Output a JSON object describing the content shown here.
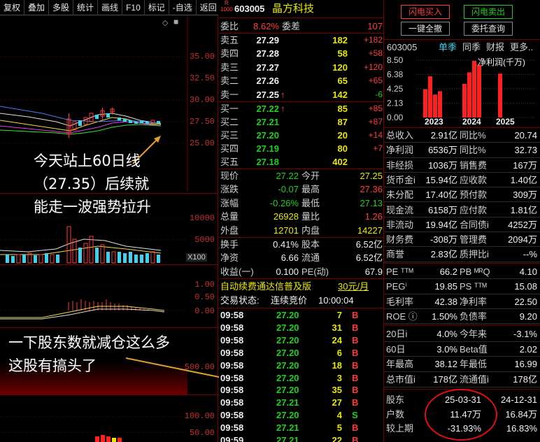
{
  "toolbar": {
    "items": [
      "复权",
      "叠加",
      "多股",
      "统计",
      "画线",
      "F10",
      "标记",
      "-自选",
      "返回"
    ]
  },
  "chart": {
    "price_ticks": [
      "35.00",
      "32.50",
      "30.00",
      "27.50",
      "25.00"
    ],
    "volume_ticks": [
      "10000",
      "5000"
    ],
    "volume_unit": "X100",
    "macd_ticks": [
      "1.00",
      "0.50",
      "0.00"
    ],
    "holder_ticks": [
      "500.00"
    ],
    "bottom_ticks": [
      "100.00",
      "50.00"
    ],
    "note1": [
      "今天站上60日线",
      "（27.35）后续就",
      "能走一波强势拉升"
    ],
    "note2": [
      "一下股东数就减仓这么多",
      "这股有搞头了"
    ]
  },
  "quote": {
    "badge_top": "R",
    "badge_bottom": "1000",
    "code": "603005",
    "name": "晶方科技",
    "wb_label": "委比",
    "wb_value": "8.62%",
    "wc_label": "委差",
    "wc_value": "107",
    "asks": [
      {
        "label": "卖五",
        "price": "27.29",
        "vol": "182",
        "chg": "+182"
      },
      {
        "label": "卖四",
        "price": "27.28",
        "vol": "58",
        "chg": "+58"
      },
      {
        "label": "卖三",
        "price": "27.27",
        "vol": "120",
        "chg": "+120"
      },
      {
        "label": "卖二",
        "price": "27.26",
        "vol": "65",
        "chg": "+65"
      },
      {
        "label": "卖一",
        "price": "27.25",
        "vol": "142",
        "chg": "-6",
        "arrow": "↑"
      }
    ],
    "bids": [
      {
        "label": "买一",
        "price": "27.22",
        "vol": "85",
        "chg": "+85",
        "arrow": "↑"
      },
      {
        "label": "买二",
        "price": "27.21",
        "vol": "87",
        "chg": "+87"
      },
      {
        "label": "买三",
        "price": "27.20",
        "vol": "20",
        "chg": "+14"
      },
      {
        "label": "买四",
        "price": "27.19",
        "vol": "80",
        "chg": "+7"
      },
      {
        "label": "买五",
        "price": "27.18",
        "vol": "402",
        "chg": ""
      }
    ],
    "stats": [
      [
        "现价",
        "27.22",
        "今开",
        "27.25"
      ],
      [
        "涨跌",
        "-0.07",
        "最高",
        "27.36"
      ],
      [
        "涨幅",
        "-0.26%",
        "最低",
        "27.13"
      ],
      [
        "总量",
        "26928",
        "量比",
        "1.26"
      ],
      [
        "外盘",
        "12701",
        "内盘",
        "14227"
      ]
    ],
    "stats2": [
      [
        "换手",
        "0.41%",
        "股本",
        "6.52亿"
      ],
      [
        "净资",
        "6.66",
        "流通",
        "6.52亿"
      ],
      [
        "收益(一)",
        "0.100",
        "PE(动)",
        "67.9"
      ]
    ],
    "ad_text": "自动续费通达信普及版",
    "ad_price": "30元/月",
    "status_label": "交易状态:",
    "status_value": "连续竞价",
    "status_time": "10:00:04",
    "ticks": [
      [
        "09:58",
        "27.20",
        "7",
        "B"
      ],
      [
        "09:58",
        "27.20",
        "31",
        "B"
      ],
      [
        "09:58",
        "27.20",
        "24",
        "B"
      ],
      [
        "09:58",
        "27.20",
        "6",
        "B"
      ],
      [
        "09:58",
        "27.20",
        "18",
        "B"
      ],
      [
        "09:58",
        "27.20",
        "3",
        "B"
      ],
      [
        "09:58",
        "27.20",
        "35",
        "B"
      ],
      [
        "09:58",
        "27.21",
        "27",
        "B"
      ],
      [
        "09:58",
        "27.20",
        "4",
        "S"
      ],
      [
        "09:58",
        "27.21",
        "5",
        "B"
      ],
      [
        "09:59",
        "27.21",
        "22",
        "B"
      ]
    ]
  },
  "right": {
    "btn_flash_buy": "闪电买入",
    "btn_flash_sell": "闪电卖出",
    "btn_cancel_all": "一键全撤",
    "btn_order_query": "委托查询",
    "code": "603005",
    "tabs": [
      "单季",
      "同季",
      "财报",
      "更多.."
    ],
    "fin_ticks": [
      "8.50",
      "6.38",
      "4.25",
      "2.13",
      "0.00"
    ],
    "fin_legend": "净利润(千万)",
    "fin_years": [
      "2023",
      "2024",
      "2025"
    ],
    "fin_bars": [
      4.2,
      6.1,
      3.4,
      3.9,
      5.0,
      6.7,
      8.4,
      7.8,
      6.5
    ],
    "fin_rows": [
      [
        "总收入",
        "2.91亿",
        "同比%",
        "20.74"
      ],
      [
        "净利润",
        "6536万",
        "同比%",
        "32.73"
      ],
      [
        "非经损",
        "1036万",
        "销售费",
        "167万"
      ],
      [
        "货币金i",
        "15.94亿",
        "应收款",
        "1.40亿"
      ],
      [
        "未分配",
        "17.40亿",
        "预付款",
        "309万"
      ],
      [
        "现金流",
        "6158万",
        "应付款",
        "1.81亿"
      ],
      [
        "非流动",
        "19.94亿",
        "合同债i",
        "4252万"
      ],
      [
        "财务费",
        "-308万",
        "管理费",
        "2094万"
      ],
      [
        "商誉",
        "2.83亿",
        "质押比i",
        "--%"
      ]
    ],
    "val_rows": [
      [
        "PE ᵀᵀᴹ",
        "66.2",
        "PB ᴹᴿQ",
        "4.10"
      ],
      [
        "PEGⁱ",
        "19.85",
        "PS ᵀᵀᴹ",
        "15.08"
      ],
      [
        "毛利率",
        "42.38",
        "净利率",
        "22.50"
      ],
      [
        "ROE ⓘ",
        "1.50%",
        "负债率",
        "9.20"
      ]
    ],
    "perf_rows": [
      [
        "20日i",
        "4.0%",
        "今年来",
        "-3.1%"
      ],
      [
        "60日",
        "3.0%",
        "Beta值",
        "2.02"
      ],
      [
        "年最高",
        "38.12",
        "年最低",
        "16.99"
      ],
      [
        "总市值i",
        "178亿",
        "流通值i",
        "178亿"
      ]
    ],
    "holder_rows": [
      [
        "股东",
        "25-03-31",
        "24-12-31"
      ],
      [
        "户数",
        "11.47万",
        "16.84万"
      ],
      [
        "较上期",
        "-31.93%",
        "16.83%"
      ]
    ]
  }
}
